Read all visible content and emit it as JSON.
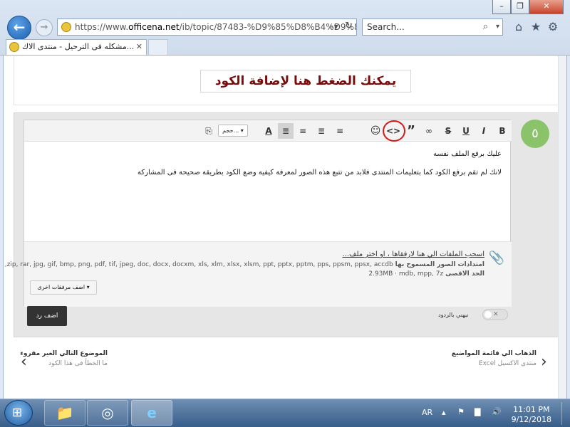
{
  "browser": {
    "url_prefix": "https://www.",
    "url_domain": "officena.net",
    "url_rest": "/ib/topic/87483-%D9%85%D8%B4%D9%83",
    "search_placeholder": "Search...",
    "tab_title": "مشكله فى الترحيل - منتدى الاك...",
    "window_controls": {
      "minimize": "–",
      "restore": "❐",
      "close": "✕"
    }
  },
  "callout": {
    "text": "يمكنك الضغط هنا لإضافة الكود"
  },
  "post": {
    "number": "٥"
  },
  "toolbar": {
    "font_size_label": "حجم..."
  },
  "editor": {
    "line1": "عليك برفع الملف نفسه",
    "line2": "لانك لم تقم برفع الكود كما بتعليمات المنتدى فلابد من تتبع هذه الصور لمعرفة كيفية وضع الكود بطريقة صحيحة فى المشاركة"
  },
  "attachments": {
    "drag_text": "اسحب الملفات الي هنا لارفقاها ، او ",
    "choose_file": "اختر ملف...",
    "allowed_label": "امتدادات الصور المسموح بها",
    "allowed_types": "zip, rar, jpg, gif, bmp, png, pdf, tif, jpeg, doc, docx, docxm, xls, xlm, xlsx, xlsm, ppt, pptx, pptm, pps, ppsm, ppsx, accdb,",
    "allowed_types2": "mdb, mpp, 7z",
    "max_label": "الحد الاقصى",
    "max_value": "2.93MB",
    "more_button": "اضف مرفقات اخرى"
  },
  "submit": {
    "label": "اضف رد"
  },
  "notify": {
    "label": "نبهني بالردود",
    "toggle": "✕"
  },
  "nav": {
    "next_title": "الموضوع التالي الغير مقروء",
    "next_sub": "ما الخطأ فى هذا الكود",
    "back_title": "الذهاب الي قائمة المواضيع",
    "back_sub": "منتدى الاكسيل Excel"
  },
  "taskbar": {
    "language": "AR",
    "time": "11:01 PM",
    "date": "9/12/2018"
  }
}
